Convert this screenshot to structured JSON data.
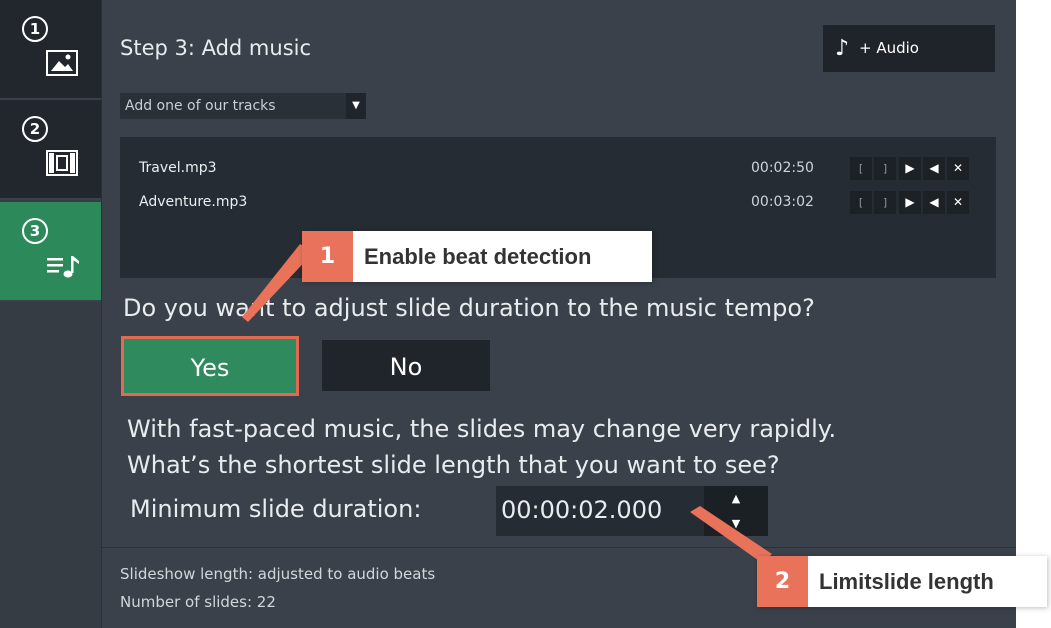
{
  "sidebar": {
    "steps": [
      {
        "number": "1",
        "icon": "image-icon"
      },
      {
        "number": "2",
        "icon": "film-icon"
      },
      {
        "number": "3",
        "icon": "music-list-icon"
      }
    ]
  },
  "header": {
    "title": "Step 3: Add music",
    "audio_button_label": "+ Audio",
    "audio_button_icon": "music-note-icon"
  },
  "tracks_dropdown": {
    "value": "Add one of our tracks"
  },
  "tracks": [
    {
      "name": "Travel.mp3",
      "duration": "00:02:50"
    },
    {
      "name": "Adventure.mp3",
      "duration": "00:03:02"
    }
  ],
  "track_controls": [
    "[",
    "]",
    "▶",
    "◀",
    "✕"
  ],
  "beat": {
    "question": "Do you want to adjust slide duration to the music tempo?",
    "yes_label": "Yes",
    "no_label": "No",
    "info_line1": "With fast-paced music, the slides may change very rapidly.",
    "info_line2": "What’s the shortest slide length that you want to see?",
    "min_label": "Minimum slide duration:",
    "min_value": "00:00:02.000"
  },
  "footer": {
    "slideshow_length": "Slideshow length: adjusted to audio beats",
    "number_of_slides": "Number of slides: 22"
  },
  "callouts": [
    {
      "number": "1",
      "text": "Enable beat detection"
    },
    {
      "number": "2",
      "text": "Limitslide length"
    }
  ],
  "colors": {
    "accent_green": "#2f8b5d",
    "callout_orange": "#e8735a",
    "panel_bg": "#3a414a"
  }
}
